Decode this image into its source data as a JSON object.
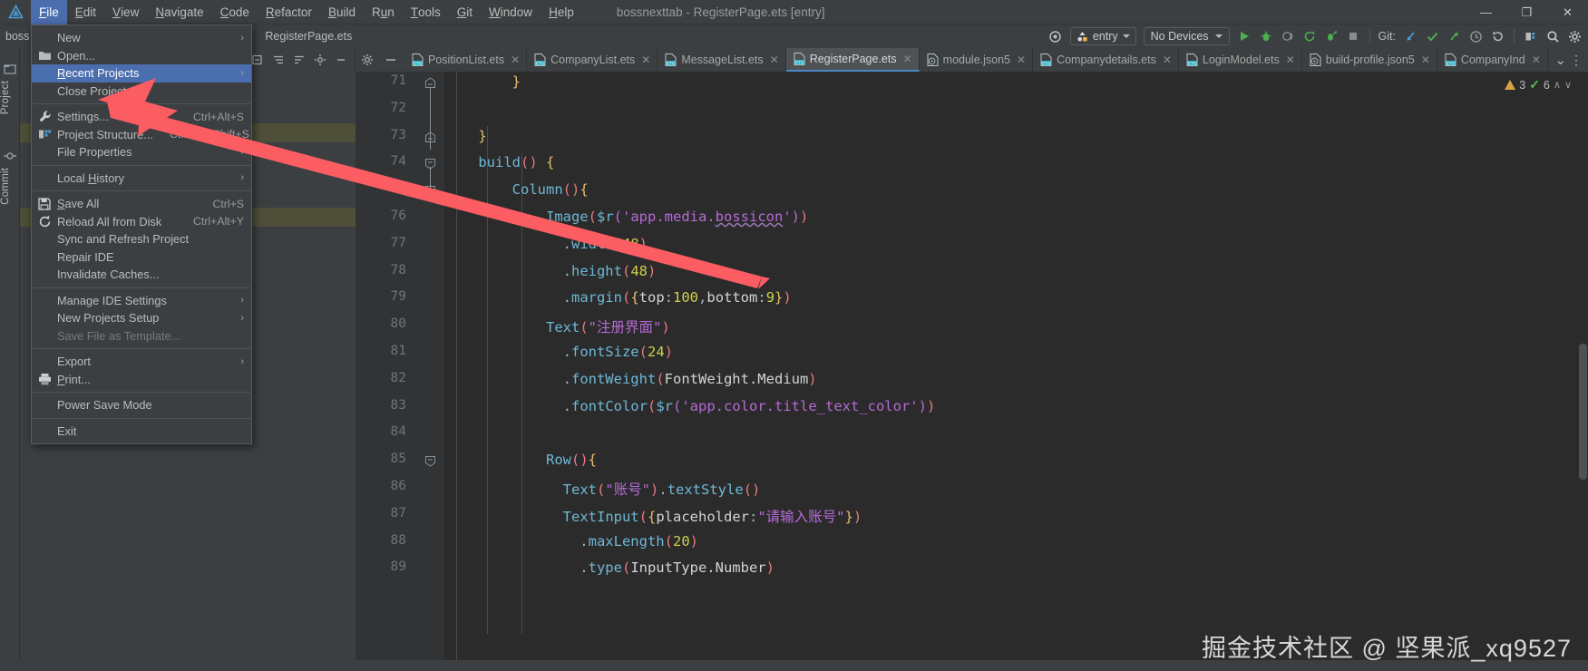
{
  "window": {
    "title": "bossnexttab - RegisterPage.ets [entry]",
    "minimize": "—",
    "maximize": "❐",
    "close": "✕"
  },
  "menubar": {
    "items": [
      {
        "label": "File",
        "mnemonic": "F",
        "active": true
      },
      {
        "label": "Edit",
        "mnemonic": "E",
        "active": false
      },
      {
        "label": "View",
        "mnemonic": "V",
        "active": false
      },
      {
        "label": "Navigate",
        "mnemonic": "N",
        "active": false
      },
      {
        "label": "Code",
        "mnemonic": "C",
        "active": false
      },
      {
        "label": "Refactor",
        "mnemonic": "R",
        "active": false
      },
      {
        "label": "Build",
        "mnemonic": "B",
        "active": false
      },
      {
        "label": "Run",
        "mnemonic": "u",
        "active": false
      },
      {
        "label": "Tools",
        "mnemonic": "T",
        "active": false
      },
      {
        "label": "Git",
        "mnemonic": "G",
        "active": false
      },
      {
        "label": "Window",
        "mnemonic": "W",
        "active": false
      },
      {
        "label": "Help",
        "mnemonic": "H",
        "active": false
      }
    ]
  },
  "file_menu": {
    "items": [
      {
        "label": "New",
        "icon": "",
        "shortcut": "",
        "submenu": true,
        "selected": false,
        "disabled": false
      },
      {
        "label": "Open...",
        "icon": "folder-icon",
        "shortcut": "",
        "submenu": false,
        "selected": false,
        "disabled": false
      },
      {
        "label": "Recent Projects",
        "icon": "",
        "shortcut": "",
        "submenu": true,
        "selected": true,
        "disabled": false,
        "mnemonic": "R"
      },
      {
        "label": "Close Project",
        "icon": "",
        "shortcut": "",
        "submenu": false,
        "selected": false,
        "disabled": false
      },
      {
        "separator": true
      },
      {
        "label": "Settings...",
        "icon": "wrench-icon",
        "shortcut": "Ctrl+Alt+S",
        "submenu": false,
        "selected": false,
        "disabled": false
      },
      {
        "label": "Project Structure...",
        "icon": "structure-icon",
        "shortcut": "Ctrl+Alt+Shift+S",
        "submenu": false,
        "selected": false,
        "disabled": false
      },
      {
        "label": "File Properties",
        "icon": "",
        "shortcut": "",
        "submenu": true,
        "selected": false,
        "disabled": false
      },
      {
        "separator": true
      },
      {
        "label": "Local History",
        "icon": "",
        "shortcut": "",
        "submenu": true,
        "selected": false,
        "disabled": false,
        "mnemonic": "H"
      },
      {
        "separator": true
      },
      {
        "label": "Save All",
        "icon": "save-icon",
        "shortcut": "Ctrl+S",
        "submenu": false,
        "selected": false,
        "disabled": false,
        "mnemonic": "S"
      },
      {
        "label": "Reload All from Disk",
        "icon": "reload-icon",
        "shortcut": "Ctrl+Alt+Y",
        "submenu": false,
        "selected": false,
        "disabled": false
      },
      {
        "label": "Sync and Refresh Project",
        "icon": "",
        "shortcut": "",
        "submenu": false,
        "selected": false,
        "disabled": false
      },
      {
        "label": "Repair IDE",
        "icon": "",
        "shortcut": "",
        "submenu": false,
        "selected": false,
        "disabled": false
      },
      {
        "label": "Invalidate Caches...",
        "icon": "",
        "shortcut": "",
        "submenu": false,
        "selected": false,
        "disabled": false
      },
      {
        "separator": true
      },
      {
        "label": "Manage IDE Settings",
        "icon": "",
        "shortcut": "",
        "submenu": true,
        "selected": false,
        "disabled": false
      },
      {
        "label": "New Projects Setup",
        "icon": "",
        "shortcut": "",
        "submenu": true,
        "selected": false,
        "disabled": false
      },
      {
        "label": "Save File as Template...",
        "icon": "",
        "shortcut": "",
        "submenu": false,
        "selected": false,
        "disabled": true
      },
      {
        "separator": true
      },
      {
        "label": "Export",
        "icon": "",
        "shortcut": "",
        "submenu": true,
        "selected": false,
        "disabled": false
      },
      {
        "label": "Print...",
        "icon": "printer-icon",
        "shortcut": "",
        "submenu": false,
        "selected": false,
        "disabled": false,
        "mnemonic": "P"
      },
      {
        "separator": true
      },
      {
        "label": "Power Save Mode",
        "icon": "",
        "shortcut": "",
        "submenu": false,
        "selected": false,
        "disabled": false
      },
      {
        "separator": true
      },
      {
        "label": "Exit",
        "icon": "",
        "shortcut": "",
        "submenu": false,
        "selected": false,
        "disabled": false
      }
    ]
  },
  "toolbar": {
    "breadcrumb_project": "boss",
    "breadcrumb_file": "RegisterPage.ets",
    "run_config": "entry",
    "device": "No Devices",
    "git_label": "Git:",
    "target_icon": "target-icon",
    "run_icon": "run-triangle-icon",
    "debug_icon": "debug-bug-icon",
    "profile_icon": "profile-icon",
    "rerun_icon": "rerun-icon",
    "attach_icon": "attach-debug-icon",
    "stop_icon": "stop-square-icon",
    "update_icon": "git-update-icon",
    "commit_icon": "git-commit-check-icon",
    "push_icon": "git-push-icon",
    "history_icon": "history-clock-icon",
    "rollback_icon": "rollback-icon",
    "structure_icon": "project-structure-icon",
    "search_icon": "search-icon",
    "settings_icon": "gear-icon"
  },
  "left_tools": [
    {
      "label": "Project",
      "icon": "project-folder-icon"
    },
    {
      "label": "Commit",
      "icon": "commit-icon"
    }
  ],
  "project_panel": {
    "header_icons": [
      "collapse-all-icon",
      "expand-all-icon",
      "sort-icon",
      "settings-gear-icon",
      "hide-icon"
    ],
    "tree_rows": [
      {
        "indent": 0,
        "label": "",
        "highlight": false
      },
      {
        "indent": 0,
        "label": "",
        "highlight": true
      },
      {
        "indent": 0,
        "label": "",
        "highlight": false
      },
      {
        "indent": 0,
        "label": "",
        "highlight": true
      }
    ]
  },
  "editor_tabs": {
    "tabs": [
      {
        "label": "PositionList.ets",
        "icon": "ets-file-icon",
        "active": false
      },
      {
        "label": "CompanyList.ets",
        "icon": "ets-file-icon",
        "active": false
      },
      {
        "label": "MessageList.ets",
        "icon": "ets-file-icon",
        "active": false
      },
      {
        "label": "RegisterPage.ets",
        "icon": "ets-file-icon",
        "active": true
      },
      {
        "label": "module.json5",
        "icon": "json5-file-icon",
        "active": false
      },
      {
        "label": "Companydetails.ets",
        "icon": "ets-file-icon",
        "active": false
      },
      {
        "label": "LoginModel.ets",
        "icon": "ets-file-icon",
        "active": false
      },
      {
        "label": "build-profile.json5",
        "icon": "json5-file-icon",
        "active": false
      },
      {
        "label": "CompanyInd",
        "icon": "ets-file-icon",
        "active": false
      }
    ],
    "close_glyph": "✕",
    "overflow_chevron": "⌄",
    "more_glyph": "⋮"
  },
  "inspection": {
    "warning_count": "3",
    "ok_count": "6",
    "up_chevron": "∧",
    "down_chevron": "∨"
  },
  "editor": {
    "first_line": 71,
    "lines": [
      {
        "num": 71,
        "fold": "end",
        "tokens": [
          {
            "t": "        ",
            "c": "t-plain"
          },
          {
            "t": "}",
            "c": "t-brace-y"
          }
        ]
      },
      {
        "num": 72,
        "fold": "",
        "tokens": []
      },
      {
        "num": 73,
        "fold": "end",
        "tokens": [
          {
            "t": "    ",
            "c": "t-plain"
          },
          {
            "t": "}",
            "c": "t-brace-y"
          }
        ]
      },
      {
        "num": 74,
        "fold": "start",
        "tokens": [
          {
            "t": "    ",
            "c": "t-plain"
          },
          {
            "t": "build",
            "c": "t-fn"
          },
          {
            "t": "()",
            "c": "t-paren-r"
          },
          {
            "t": " ",
            "c": "t-plain"
          },
          {
            "t": "{",
            "c": "t-brace-y"
          }
        ]
      },
      {
        "num": 75,
        "fold": "start",
        "tokens": [
          {
            "t": "        ",
            "c": "t-plain"
          },
          {
            "t": "Column",
            "c": "t-fn"
          },
          {
            "t": "()",
            "c": "t-paren-r"
          },
          {
            "t": "{",
            "c": "t-brace-y"
          }
        ]
      },
      {
        "num": 76,
        "fold": "",
        "tokens": [
          {
            "t": "            ",
            "c": "t-plain"
          },
          {
            "t": "Image",
            "c": "t-fn"
          },
          {
            "t": "(",
            "c": "t-paren-r"
          },
          {
            "t": "$r",
            "c": "t-fn"
          },
          {
            "t": "(",
            "c": "t-paren-v"
          },
          {
            "t": "'app.media.",
            "c": "t-str"
          },
          {
            "t": "bossicon",
            "c": "t-str squiggle"
          },
          {
            "t": "'",
            "c": "t-str"
          },
          {
            "t": ")",
            "c": "t-paren-v"
          },
          {
            "t": ")",
            "c": "t-paren-r"
          }
        ]
      },
      {
        "num": 77,
        "fold": "",
        "tokens": [
          {
            "t": "              .",
            "c": "t-plain"
          },
          {
            "t": "width",
            "c": "t-fn"
          },
          {
            "t": "(",
            "c": "t-paren-r"
          },
          {
            "t": "48",
            "c": "t-num"
          },
          {
            "t": ")",
            "c": "t-paren-r"
          }
        ]
      },
      {
        "num": 78,
        "fold": "",
        "tokens": [
          {
            "t": "              .",
            "c": "t-plain"
          },
          {
            "t": "height",
            "c": "t-fn"
          },
          {
            "t": "(",
            "c": "t-paren-r"
          },
          {
            "t": "48",
            "c": "t-num"
          },
          {
            "t": ")",
            "c": "t-paren-r"
          }
        ]
      },
      {
        "num": 79,
        "fold": "",
        "tokens": [
          {
            "t": "              .",
            "c": "t-plain"
          },
          {
            "t": "margin",
            "c": "t-fn"
          },
          {
            "t": "(",
            "c": "t-paren-r"
          },
          {
            "t": "{",
            "c": "t-brace-y"
          },
          {
            "t": "top",
            "c": "t-white"
          },
          {
            "t": ":",
            "c": "t-plain"
          },
          {
            "t": "100",
            "c": "t-num"
          },
          {
            "t": ",",
            "c": "t-plain"
          },
          {
            "t": "bottom",
            "c": "t-white"
          },
          {
            "t": ":",
            "c": "t-plain"
          },
          {
            "t": "9",
            "c": "t-num"
          },
          {
            "t": "}",
            "c": "t-brace-y"
          },
          {
            "t": ")",
            "c": "t-paren-r"
          }
        ]
      },
      {
        "num": 80,
        "fold": "",
        "tokens": [
          {
            "t": "            ",
            "c": "t-plain"
          },
          {
            "t": "Text",
            "c": "t-fn"
          },
          {
            "t": "(",
            "c": "t-paren-r"
          },
          {
            "t": "\"注册界面\"",
            "c": "t-str"
          },
          {
            "t": ")",
            "c": "t-paren-r"
          }
        ]
      },
      {
        "num": 81,
        "fold": "",
        "tokens": [
          {
            "t": "              .",
            "c": "t-plain"
          },
          {
            "t": "fontSize",
            "c": "t-fn"
          },
          {
            "t": "(",
            "c": "t-paren-r"
          },
          {
            "t": "24",
            "c": "t-num"
          },
          {
            "t": ")",
            "c": "t-paren-r"
          }
        ]
      },
      {
        "num": 82,
        "fold": "",
        "tokens": [
          {
            "t": "              .",
            "c": "t-plain"
          },
          {
            "t": "fontWeight",
            "c": "t-fn"
          },
          {
            "t": "(",
            "c": "t-paren-r"
          },
          {
            "t": "FontWeight.Medium",
            "c": "t-white"
          },
          {
            "t": ")",
            "c": "t-paren-r"
          }
        ]
      },
      {
        "num": 83,
        "fold": "",
        "tokens": [
          {
            "t": "              .",
            "c": "t-plain"
          },
          {
            "t": "fontColor",
            "c": "t-fn"
          },
          {
            "t": "(",
            "c": "t-paren-r"
          },
          {
            "t": "$r",
            "c": "t-fn"
          },
          {
            "t": "(",
            "c": "t-paren-v"
          },
          {
            "t": "'app.color.title_text_color'",
            "c": "t-str"
          },
          {
            "t": ")",
            "c": "t-paren-v"
          },
          {
            "t": ")",
            "c": "t-paren-r"
          }
        ]
      },
      {
        "num": 84,
        "fold": "",
        "tokens": []
      },
      {
        "num": 85,
        "fold": "start",
        "tokens": [
          {
            "t": "            ",
            "c": "t-plain"
          },
          {
            "t": "Row",
            "c": "t-fn"
          },
          {
            "t": "()",
            "c": "t-paren-r"
          },
          {
            "t": "{",
            "c": "t-brace-y"
          }
        ]
      },
      {
        "num": 86,
        "fold": "",
        "tokens": [
          {
            "t": "              ",
            "c": "t-plain"
          },
          {
            "t": "Text",
            "c": "t-fn"
          },
          {
            "t": "(",
            "c": "t-paren-r"
          },
          {
            "t": "\"账号\"",
            "c": "t-str"
          },
          {
            "t": ")",
            "c": "t-paren-r"
          },
          {
            "t": ".",
            "c": "t-plain"
          },
          {
            "t": "textStyle",
            "c": "t-fn"
          },
          {
            "t": "()",
            "c": "t-paren-r"
          }
        ]
      },
      {
        "num": 87,
        "fold": "",
        "tokens": [
          {
            "t": "              ",
            "c": "t-plain"
          },
          {
            "t": "TextInput",
            "c": "t-fn"
          },
          {
            "t": "(",
            "c": "t-paren-r"
          },
          {
            "t": "{",
            "c": "t-brace-y"
          },
          {
            "t": "placeholder",
            "c": "t-white"
          },
          {
            "t": ":",
            "c": "t-plain"
          },
          {
            "t": "\"请输入账号\"",
            "c": "t-str"
          },
          {
            "t": "}",
            "c": "t-brace-y"
          },
          {
            "t": ")",
            "c": "t-paren-r"
          }
        ]
      },
      {
        "num": 88,
        "fold": "",
        "tokens": [
          {
            "t": "                .",
            "c": "t-plain"
          },
          {
            "t": "maxLength",
            "c": "t-fn"
          },
          {
            "t": "(",
            "c": "t-paren-r"
          },
          {
            "t": "20",
            "c": "t-num"
          },
          {
            "t": ")",
            "c": "t-paren-r"
          }
        ]
      },
      {
        "num": 89,
        "fold": "",
        "tokens": [
          {
            "t": "                .",
            "c": "t-plain"
          },
          {
            "t": "type",
            "c": "t-fn"
          },
          {
            "t": "(",
            "c": "t-paren-r"
          },
          {
            "t": "InputType.Number",
            "c": "t-white"
          },
          {
            "t": ")",
            "c": "t-paren-r"
          }
        ]
      }
    ]
  },
  "annotation": {
    "arrow_color": "#fb5d62",
    "type": "red-arrow-pointing-to-settings"
  },
  "watermark": {
    "text": "掘金技术社区 @ 坚果派_xq9527"
  }
}
